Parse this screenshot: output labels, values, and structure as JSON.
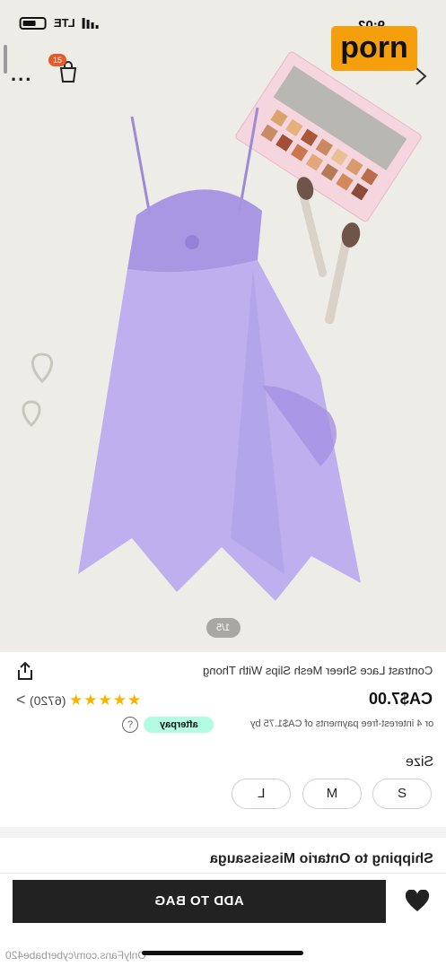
{
  "status_bar": {
    "time": "9:02",
    "network": "LTE"
  },
  "brand_badge": {
    "label": "porn",
    "color": "#f59f0d"
  },
  "header": {
    "more_label": "...",
    "cart_count": "15",
    "next_icon": "chevron-right-icon"
  },
  "gallery": {
    "pager": "1/5"
  },
  "product": {
    "title": "Contrast Lace Sheer Mesh Slips With Thong",
    "price": "CA$7.00",
    "rating": 5,
    "stars": "★★★★★",
    "reviews": "(6720)",
    "installments": "or 4 interest-free payments of CA$1.75 by",
    "afterpay_label": "afterpay",
    "help_label": "?"
  },
  "size": {
    "label": "Size",
    "options": [
      "S",
      "M",
      "L"
    ]
  },
  "shipping": {
    "label": "Shipping to Ontario Mississauga"
  },
  "actions": {
    "add_to_bag": "ADD TO BAG"
  },
  "watermark": {
    "text": "OnlyFans.com/cyberbabe420"
  },
  "colors": {
    "accent": "#222222",
    "star": "#f4b400",
    "afterpay": "#b2fce4",
    "cart_badge": "#e65a2a"
  }
}
